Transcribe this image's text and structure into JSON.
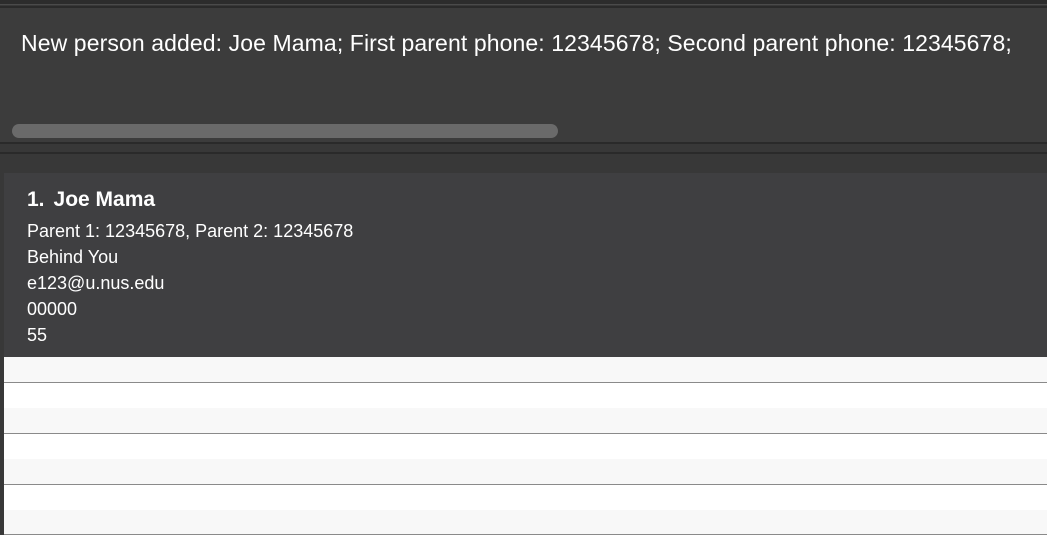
{
  "result_display": {
    "message": "New person added: Joe Mama; First parent phone: 12345678; Second parent phone: 12345678;"
  },
  "person_list": {
    "items": [
      {
        "index": "1.",
        "name": "Joe Mama",
        "parents": "Parent 1: 12345678, Parent 2: 12345678",
        "address": "Behind You",
        "email": "e123@u.nus.edu",
        "field4": "00000",
        "field5": "55"
      }
    ]
  },
  "colors": {
    "panel_bg": "#383838",
    "card_bg": "#3f3f41",
    "text": "#ffffff",
    "row_light": "#f8f8f8",
    "row_white": "#ffffff"
  }
}
